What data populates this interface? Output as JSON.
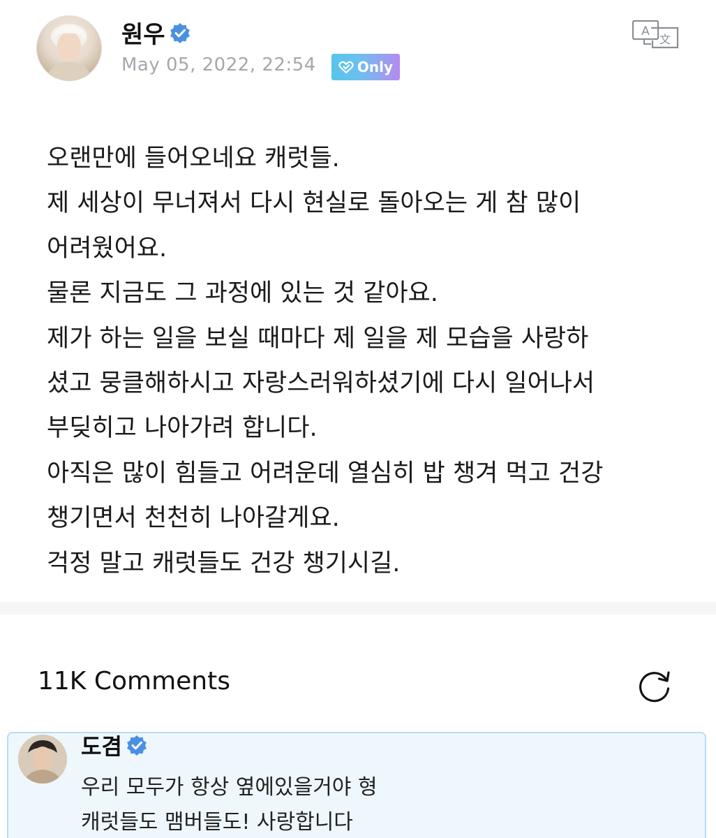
{
  "post": {
    "author": "원우",
    "date": "May 05, 2022, 22:54",
    "badge": "Only",
    "lines": [
      "오랜만에 들어오네요 캐럿들.",
      "제 세상이 무너져서 다시 현실로 돌아오는 게 참 많이",
      "어려웠어요.",
      "물론 지금도 그 과정에 있는 것 같아요.",
      "제가 하는 일을 보실 때마다 제 일을 제 모습을 사랑하",
      "셨고 뭉클해하시고 자랑스러워하셨기에 다시 일어나서",
      "부딪히고 나아가려 합니다.",
      "아직은 많이 힘들고 어려운데 열심히 밥 챙겨 먹고 건강",
      "챙기면서 천천히 나아갈게요.",
      "걱정 말고 캐럿들도 건강 챙기시길."
    ]
  },
  "comments": {
    "title": "11K Comments",
    "items": [
      {
        "author": "도겸",
        "lines": [
          "우리 모두가 항상 옆에있을거야 형",
          "캐럿들도 맴버들도! 사랑합니다"
        ]
      }
    ]
  },
  "colors": {
    "verified": "#4a90e2",
    "date": "#a5a7ad",
    "comment_bg": "#eef7fc",
    "comment_border": "#b9dcef"
  },
  "icons": {
    "verified": "verified-check-badge",
    "translate": "translate-icon",
    "refresh": "refresh-icon",
    "only": "heart-check-icon"
  }
}
